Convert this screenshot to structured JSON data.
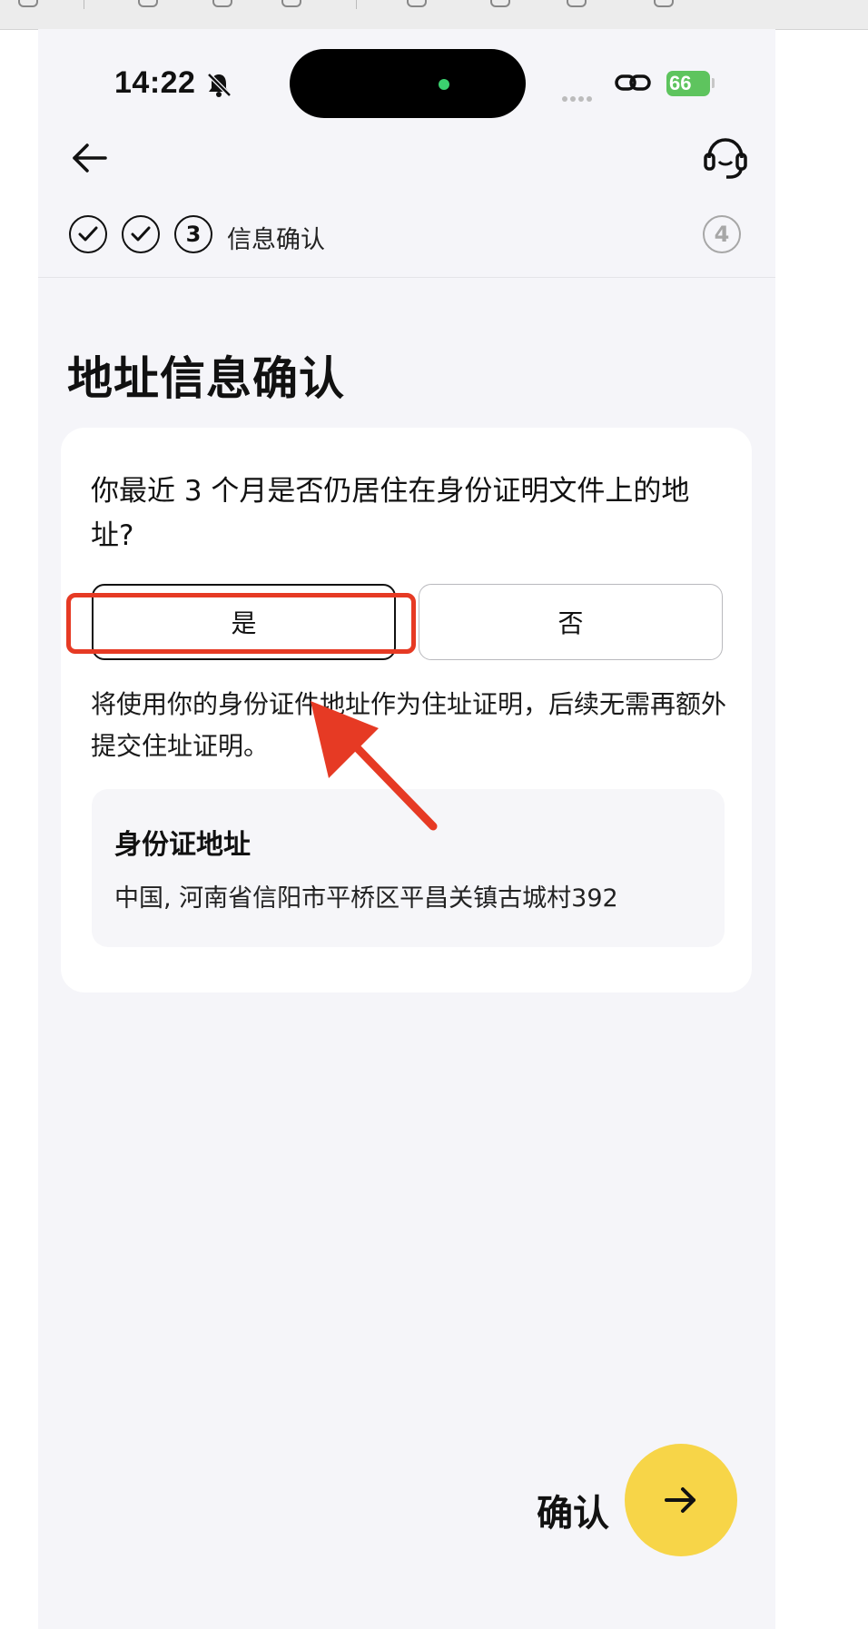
{
  "status_bar": {
    "time": "14:22",
    "battery": "66"
  },
  "stepper": {
    "steps": [
      {
        "state": "done"
      },
      {
        "state": "done"
      },
      {
        "number": "3",
        "state": "current"
      },
      {
        "number": "4",
        "state": "upcoming"
      }
    ],
    "current_label": "信息确认"
  },
  "page": {
    "title": "地址信息确认"
  },
  "question": {
    "text": "你最近 3 个月是否仍居住在身份证明文件上的地址?",
    "options": [
      {
        "label": "是",
        "selected": true
      },
      {
        "label": "否",
        "selected": false
      }
    ]
  },
  "note": "将使用你的身份证件地址作为住址证明，后续无需再额外提交住址证明。",
  "id_address": {
    "title": "身份证地址",
    "value": "中国, 河南省信阳市平桥区平昌关镇古城村392"
  },
  "footer": {
    "confirm_label": "确认"
  },
  "colors": {
    "accent": "#f7d548",
    "highlight": "#e63a24",
    "page_bg": "#f5f5f9",
    "battery": "#5ec45e"
  },
  "icons": [
    "back-arrow-icon",
    "headset-icon",
    "bell-slash-icon",
    "link-icon",
    "check-icon",
    "arrow-right-icon"
  ]
}
